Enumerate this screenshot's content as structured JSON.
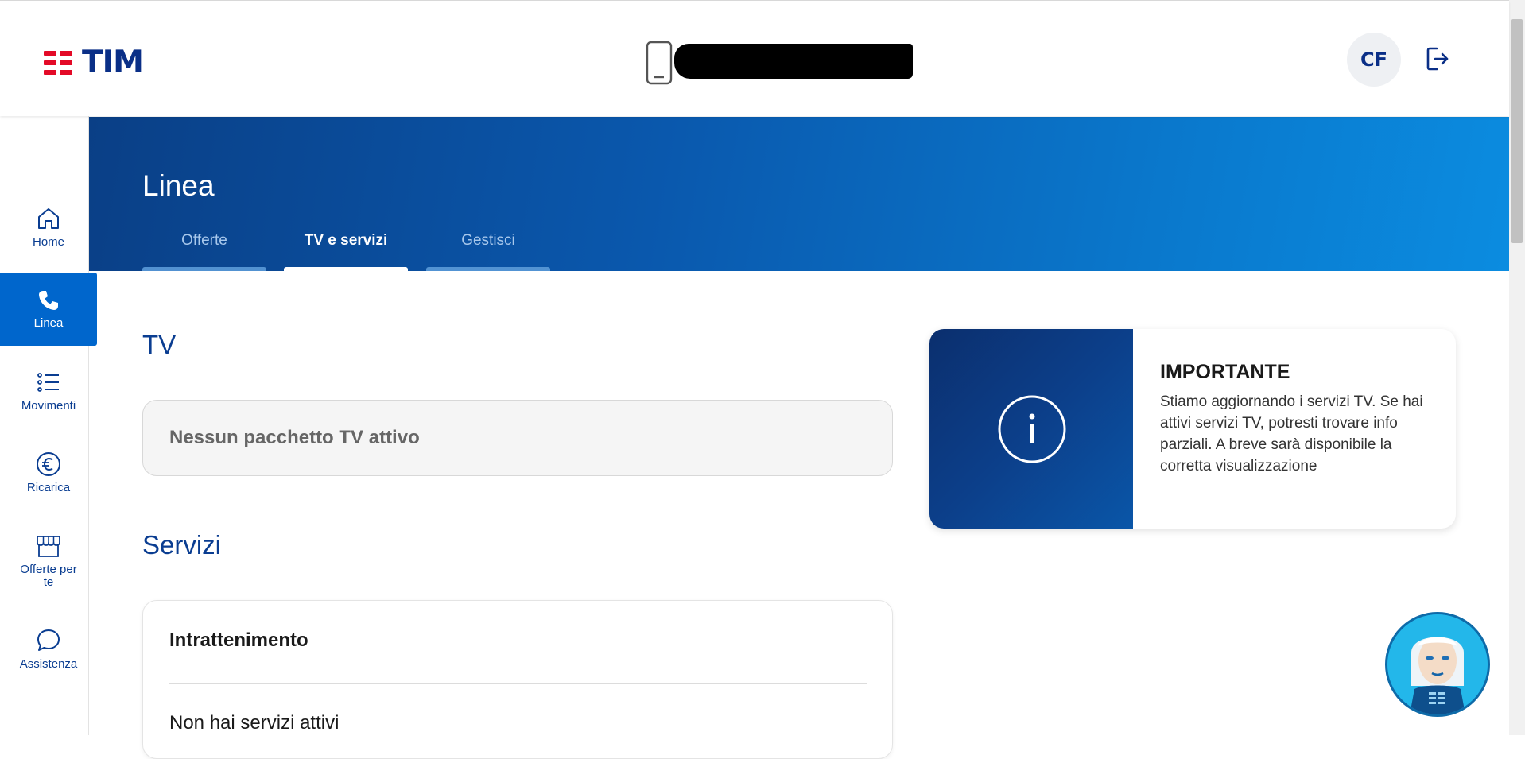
{
  "brand": {
    "name": "TIM",
    "accent": "#e30a27",
    "primary": "#0a2f87"
  },
  "header": {
    "user_initials": "CF",
    "phone_icon": "smartphone-icon",
    "logout_icon": "logout-icon"
  },
  "sidebar": {
    "items": [
      {
        "label": "Home",
        "icon": "home-icon",
        "active": false
      },
      {
        "label": "Linea",
        "icon": "phone-icon",
        "active": true
      },
      {
        "label": "Movimenti",
        "icon": "list-icon",
        "active": false
      },
      {
        "label": "Ricarica",
        "icon": "euro-icon",
        "active": false
      },
      {
        "label": "Offerte per te",
        "icon": "store-icon",
        "active": false
      },
      {
        "label": "Assistenza",
        "icon": "chat-bubble-icon",
        "active": false
      }
    ]
  },
  "banner": {
    "title": "Linea",
    "tabs": [
      {
        "label": "Offerte",
        "active": false
      },
      {
        "label": "TV e servizi",
        "active": true
      },
      {
        "label": "Gestisci",
        "active": false
      }
    ]
  },
  "main": {
    "tv": {
      "title": "TV",
      "empty_message": "Nessun pacchetto TV attivo"
    },
    "services": {
      "title": "Servizi",
      "category": "Intrattenimento",
      "empty_message": "Non hai servizi attivi"
    }
  },
  "info_card": {
    "icon": "info-icon",
    "title": "IMPORTANTE",
    "text": "Stiamo aggiornando i servizi TV. Se hai attivi servizi TV, potresti trovare info parziali. A breve sarà disponibile la corretta visualizzazione"
  },
  "chatbot": {
    "icon": "assistant-avatar-icon"
  }
}
